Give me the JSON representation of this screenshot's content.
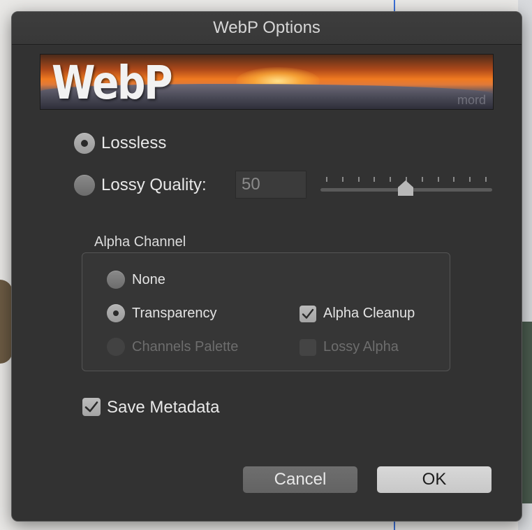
{
  "dialog": {
    "title": "WebP Options",
    "banner": {
      "logo_text": "WebP",
      "credit": "mord"
    }
  },
  "compression": {
    "lossless_label": "Lossless",
    "lossless_selected": true,
    "lossy_label": "Lossy Quality:",
    "lossy_selected": false,
    "quality_value": "50",
    "quality_slider_fraction": 0.5
  },
  "alpha": {
    "title": "Alpha Channel",
    "none_label": "None",
    "transparency_label": "Transparency",
    "channels_palette_label": "Channels Palette",
    "alpha_cleanup_label": "Alpha Cleanup",
    "alpha_cleanup_checked": true,
    "lossy_alpha_label": "Lossy Alpha",
    "lossy_alpha_checked": false
  },
  "metadata": {
    "label": "Save Metadata",
    "checked": true
  },
  "buttons": {
    "cancel": "Cancel",
    "ok": "OK"
  },
  "colors": {
    "dialog_bg": "#323232",
    "text": "#e6e6e6",
    "disabled_text": "#6d6d6d"
  }
}
